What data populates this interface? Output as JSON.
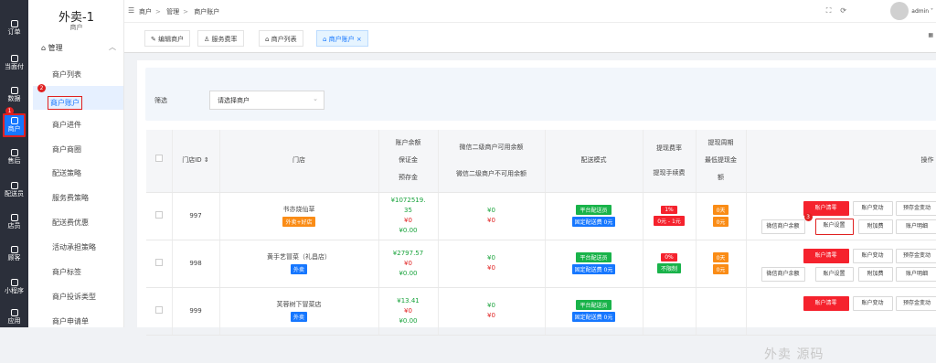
{
  "rail": [
    {
      "label": "订单",
      "icon": "order-icon"
    },
    {
      "label": "当面付",
      "icon": "pay-icon"
    },
    {
      "label": "数据",
      "icon": "data-icon"
    },
    {
      "label": "商户",
      "icon": "store-icon",
      "active": true
    },
    {
      "label": "售后",
      "icon": "headset-icon"
    },
    {
      "label": "配送员",
      "icon": "courier-icon"
    },
    {
      "label": "店员",
      "icon": "clerk-icon"
    },
    {
      "label": "顾客",
      "icon": "customer-icon"
    },
    {
      "label": "小程序",
      "icon": "miniprogram-icon"
    },
    {
      "label": "应用",
      "icon": "apps-icon"
    }
  ],
  "sidebar": {
    "title": "外卖-1",
    "subtitle": "商户",
    "group": "管理",
    "items": [
      "商户列表",
      "商户账户",
      "商户进件",
      "商户商圈",
      "配送策略",
      "服务费策略",
      "配送费优惠",
      "活动承担策略",
      "商户标签",
      "商户投诉类型",
      "商户申请单"
    ],
    "active_index": 1
  },
  "badges": {
    "one": "1",
    "two": "2",
    "three": "3"
  },
  "breadcrumb": [
    "商户",
    "管理",
    "商户账户"
  ],
  "user": {
    "name": "admin"
  },
  "tabs": [
    {
      "label": "编辑商户",
      "active": false
    },
    {
      "label": "服务费率",
      "active": false
    },
    {
      "label": "商户列表",
      "active": false
    },
    {
      "label": "商户账户",
      "active": true
    }
  ],
  "filter": {
    "label": "筛选",
    "placeholder": "请选择商户"
  },
  "table": {
    "headers": {
      "id": "门店ID",
      "store": "门店",
      "balance1": "账户余额",
      "balance2": "保证金",
      "balance3": "预存金",
      "wx1": "微信二级商户可用余额",
      "wx2": "微信二级商户不可用余额",
      "mode": "配送模式",
      "rate1": "提现费率",
      "rate2": "提现手续费",
      "period1": "提现周期",
      "period2": "最低提现金",
      "period3": "额",
      "ops": "操作"
    },
    "rows": [
      {
        "id": "997",
        "name": "书亦烧仙草",
        "tag": "外卖+好店",
        "tag_color": "orange",
        "balance": "¥1072519.",
        "balance2": "35",
        "deposit": "¥0",
        "prestore": "¥0.00",
        "wx_avail": "¥0",
        "wx_unavail": "¥0",
        "mode1": "平台配送员",
        "mode2": "固定配送费 0元",
        "rate": "1%",
        "fee": "0元 - 1元",
        "period": "0天",
        "min": "0元"
      },
      {
        "id": "998",
        "name": "黄手艺冒菜（礼昌店）",
        "tag": "外卖",
        "tag_color": "blue",
        "balance": "¥2797.57",
        "deposit": "¥0",
        "prestore": "¥0.00",
        "wx_avail": "¥0",
        "wx_unavail": "¥0",
        "mode1": "平台配送员",
        "mode2": "固定配送费 0元",
        "rate": "0%",
        "fee": "不限制",
        "period": "0天",
        "min": "0元"
      },
      {
        "id": "999",
        "name": "芙蓉树下冒菜店",
        "tag": "外卖",
        "tag_color": "blue",
        "balance": "¥13.41",
        "deposit": "¥0",
        "prestore": "¥0.00",
        "wx_avail": "¥0",
        "wx_unavail": "¥0",
        "mode1": "平台配送员",
        "mode2": "固定配送费 0元",
        "rate": "",
        "fee": "",
        "period": "",
        "min": ""
      }
    ],
    "ops": {
      "withdraw": "账户清零",
      "change": "账户变动",
      "prestore_change": "预存金变动",
      "wx_balance": "微信商户余额",
      "settings": "账户设置",
      "add": "附加费",
      "detail": "账户明细"
    }
  },
  "watermark": "外卖 源码"
}
